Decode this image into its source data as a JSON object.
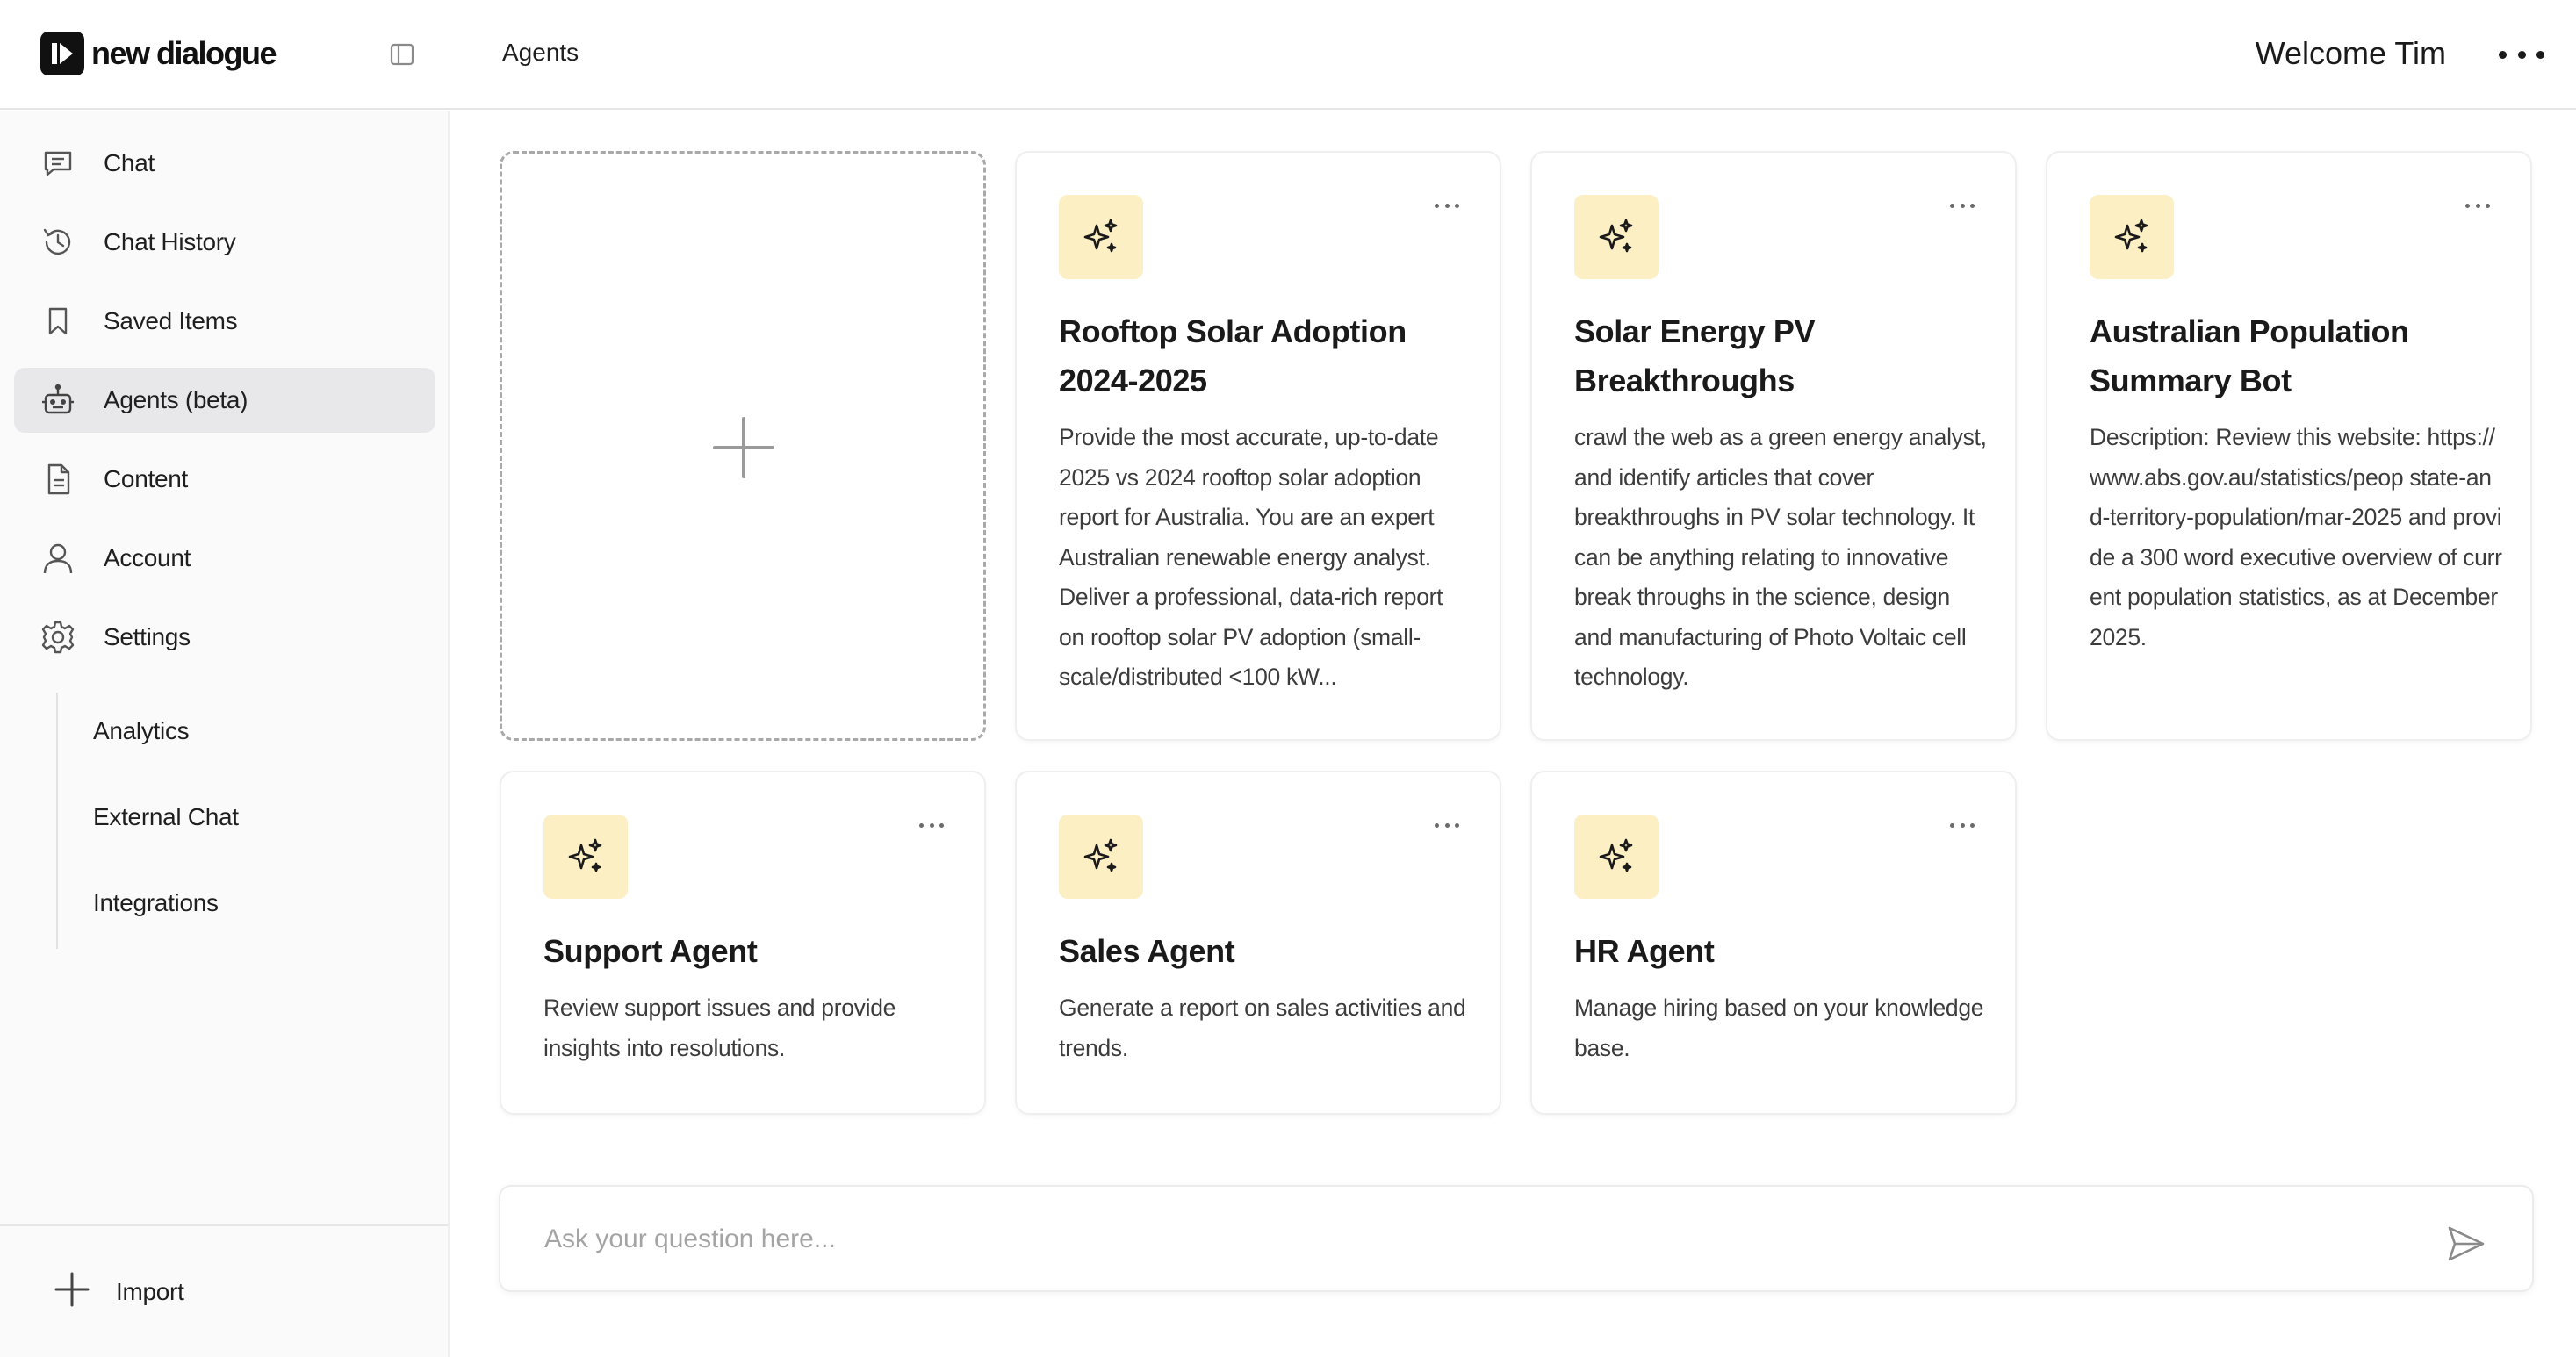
{
  "app": {
    "logo_text": "new dialogue",
    "page_title": "Agents",
    "welcome": "Welcome Tim"
  },
  "sidebar": {
    "items": [
      {
        "label": "Chat",
        "icon": "chat-icon"
      },
      {
        "label": "Chat History",
        "icon": "history-icon"
      },
      {
        "label": "Saved Items",
        "icon": "bookmark-icon"
      },
      {
        "label": "Agents (beta)",
        "icon": "robot-icon",
        "active": true
      },
      {
        "label": "Content",
        "icon": "document-icon"
      },
      {
        "label": "Account",
        "icon": "user-icon"
      },
      {
        "label": "Settings",
        "icon": "gear-icon"
      }
    ],
    "sub_items": [
      "Analytics",
      "External Chat",
      "Integrations"
    ],
    "import_label": "Import"
  },
  "agents": [
    {
      "title": "Rooftop Solar Adoption 2024-2025",
      "description": "Provide the most accurate, up-to-date 2025 vs 2024 rooftop solar adoption report for Australia. You are an expert Australian renewable energy analyst. Deliver a professional, data-rich report on rooftop solar PV adoption (small-scale/distributed <100 kW..."
    },
    {
      "title": "Solar Energy PV Breakthroughs",
      "description": "crawl the web as a green energy analyst, and identify articles that cover breakthroughs in PV solar technology. It can be anything relating to innovative break throughs in the science, design and manufacturing of Photo Voltaic cell technology."
    },
    {
      "title": "Australian Population Summary Bot",
      "description": "Description: Review this website: https://www.abs.gov.au/statistics/peop state-and-territory-population/mar-2025 and provide a 300 word executive overview of current population statistics, as at December 2025."
    },
    {
      "title": "Support Agent",
      "description": "Review support issues and provide insights into resolutions."
    },
    {
      "title": "Sales Agent",
      "description": "Generate a report on sales activities and trends."
    },
    {
      "title": "HR Agent",
      "description": "Manage hiring based on your knowledge base."
    }
  ],
  "chat": {
    "placeholder": "Ask your question here..."
  },
  "colors": {
    "agent_icon_bg": "#fdefc4",
    "active_nav_bg": "#e8e8ea",
    "sidebar_bg": "#fafafa"
  }
}
